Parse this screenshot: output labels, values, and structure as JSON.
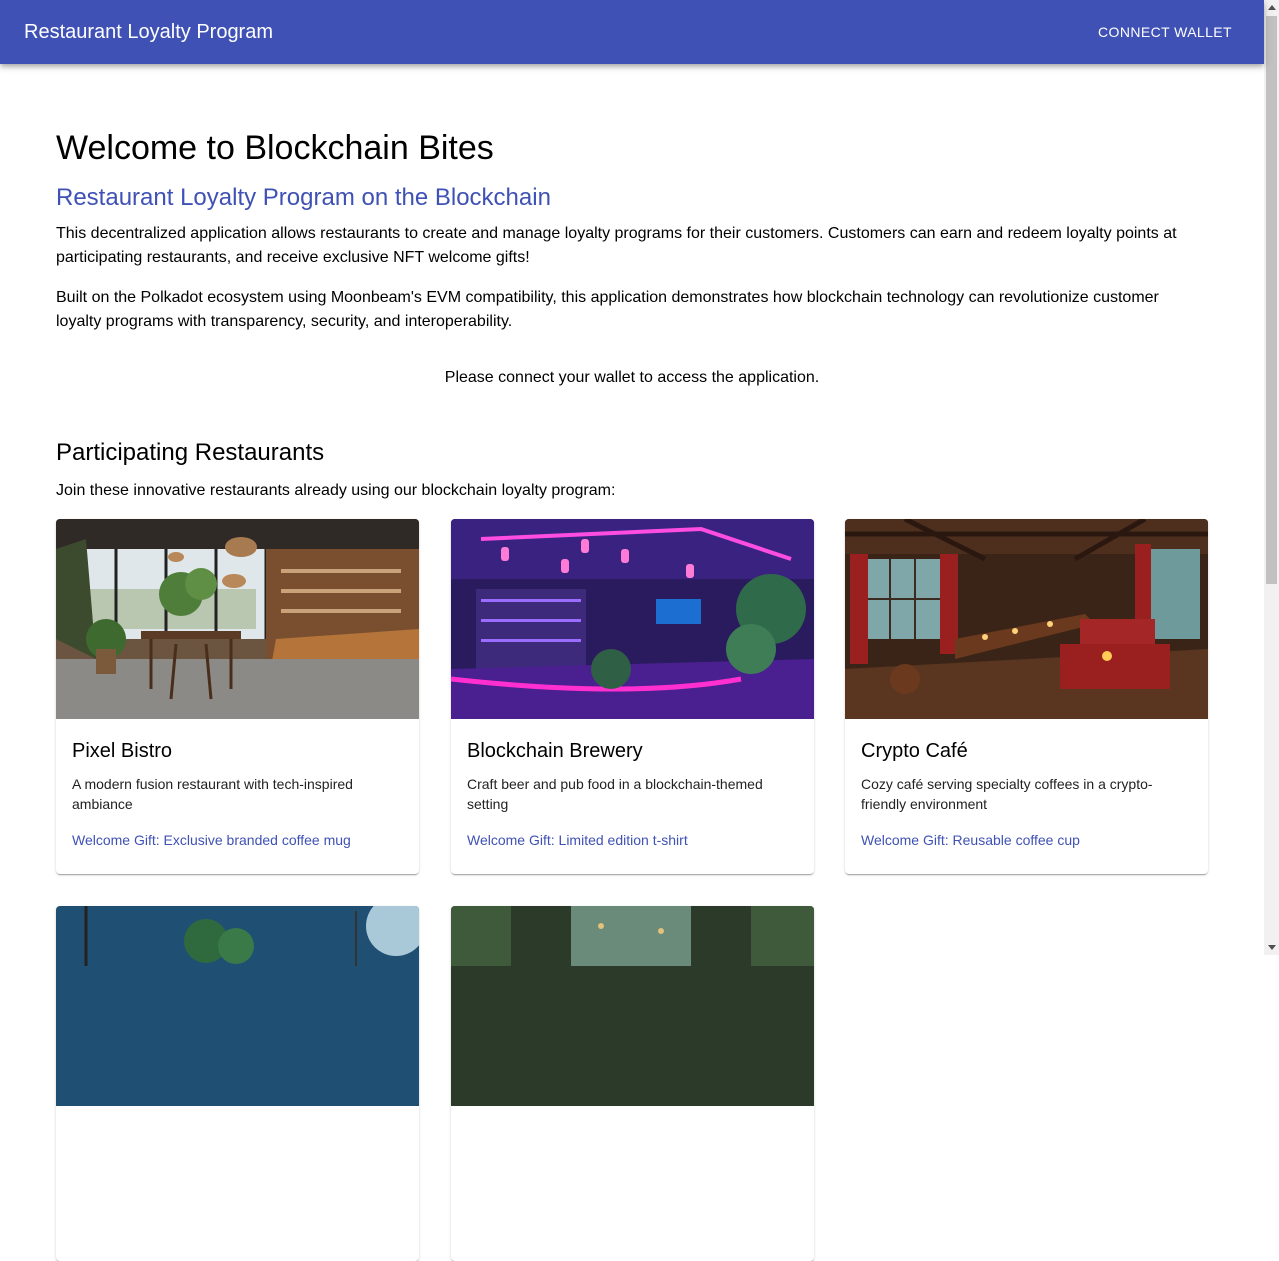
{
  "header": {
    "app_title": "Restaurant Loyalty Program",
    "connect_label": "CONNECT WALLET",
    "color": "#3f51b5"
  },
  "hero": {
    "title": "Welcome to Blockchain Bites",
    "subtitle": "Restaurant Loyalty Program on the Blockchain",
    "paragraph1": "This decentralized application allows restaurants to create and manage loyalty programs for their customers. Customers can earn and redeem loyalty points at participating restaurants, and receive exclusive NFT welcome gifts!",
    "paragraph2": "Built on the Polkadot ecosystem using Moonbeam's EVM compatibility, this application demonstrates how blockchain technology can revolutionize customer loyalty programs with transparency, security, and interoperability.",
    "notice": "Please connect your wallet to access the application."
  },
  "restaurants": {
    "heading": "Participating Restaurants",
    "intro": "Join these innovative restaurants already using our blockchain loyalty program:",
    "items": [
      {
        "name": "Pixel Bistro",
        "description": "A modern fusion restaurant with tech-inspired ambiance",
        "gift": "Welcome Gift: Exclusive branded coffee mug"
      },
      {
        "name": "Blockchain Brewery",
        "description": "Craft beer and pub food in a blockchain-themed setting",
        "gift": "Welcome Gift: Limited edition t-shirt"
      },
      {
        "name": "Crypto Café",
        "description": "Cozy café serving specialty coffees in a crypto-friendly environment",
        "gift": "Welcome Gift: Reusable coffee cup"
      }
    ]
  }
}
